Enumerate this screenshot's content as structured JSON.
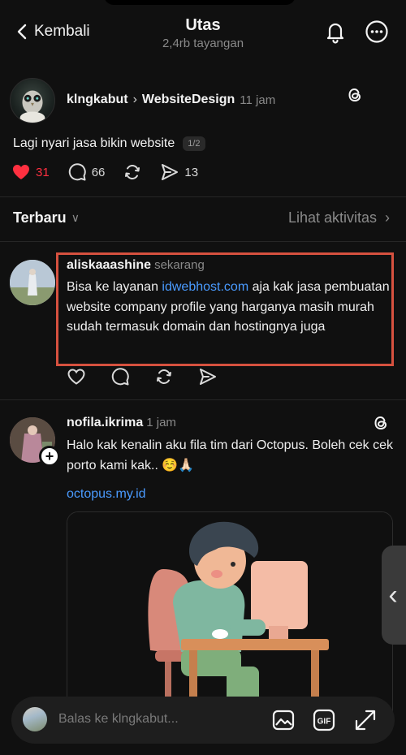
{
  "header": {
    "back_label": "Kembali",
    "title": "Utas",
    "subtitle": "2,4rb tayangan"
  },
  "post": {
    "author": "klngkabut",
    "topic": "WebsiteDesign",
    "time": "11 jam",
    "text": "Lagi nyari jasa bikin website",
    "pager": "1/2",
    "likes": "31",
    "replies": "66",
    "shares": "13"
  },
  "filter": {
    "sort_label": "Terbaru",
    "activity_label": "Lihat aktivitas"
  },
  "replies": [
    {
      "author": "aliskaaashine",
      "time": "sekarang",
      "text_before": "Bisa ke layanan",
      "link": "idwebhost.com",
      "text_after": "aja kak jasa pembuatan website company profile yang harganya masih murah sudah termasuk domain dan hostingnya juga"
    },
    {
      "author": "nofila.ikrima",
      "time": "1 jam",
      "text": "Halo kak kenalin aku fila tim dari Octopus. Boleh cek cek porto kami kak.. ☺️🙏🏻",
      "link": "octopus.my.id"
    }
  ],
  "reply_bar": {
    "placeholder": "Balas ke klngkabut..."
  },
  "colors": {
    "background": "#101010",
    "like_red": "#ff3040",
    "link_blue": "#4a9bff",
    "highlight_border": "#d6513f"
  }
}
